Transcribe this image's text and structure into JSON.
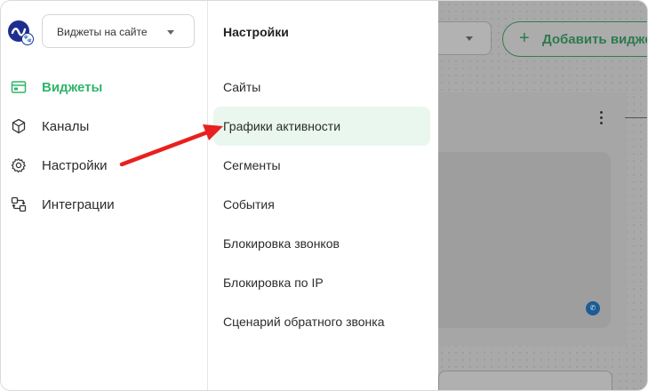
{
  "sidebar": {
    "site_select": {
      "value": "Виджеты на сайте"
    },
    "items": [
      {
        "label": "Виджеты",
        "icon": "widget-icon",
        "active": true
      },
      {
        "label": "Каналы",
        "icon": "channels-icon",
        "active": false
      },
      {
        "label": "Настройки",
        "icon": "gear-icon",
        "active": false
      },
      {
        "label": "Интеграции",
        "icon": "integrations-icon",
        "active": false
      }
    ]
  },
  "submenu": {
    "title": "Настройки",
    "items": [
      {
        "label": "Сайты"
      },
      {
        "label": "Графики активности",
        "highlighted": true
      },
      {
        "label": "Сегменты"
      },
      {
        "label": "События"
      },
      {
        "label": "Блокировка звонков"
      },
      {
        "label": "Блокировка по IP"
      },
      {
        "label": "Сценарий обратного звонка"
      }
    ]
  },
  "background": {
    "add_button_label": "Добавить виджет"
  },
  "colors": {
    "accent": "#2fb56a",
    "highlight_bg": "#e9f7ef",
    "overlay": "#a9a9a9",
    "annotation_arrow": "#e8201f",
    "logo": "#1f2f8f"
  }
}
